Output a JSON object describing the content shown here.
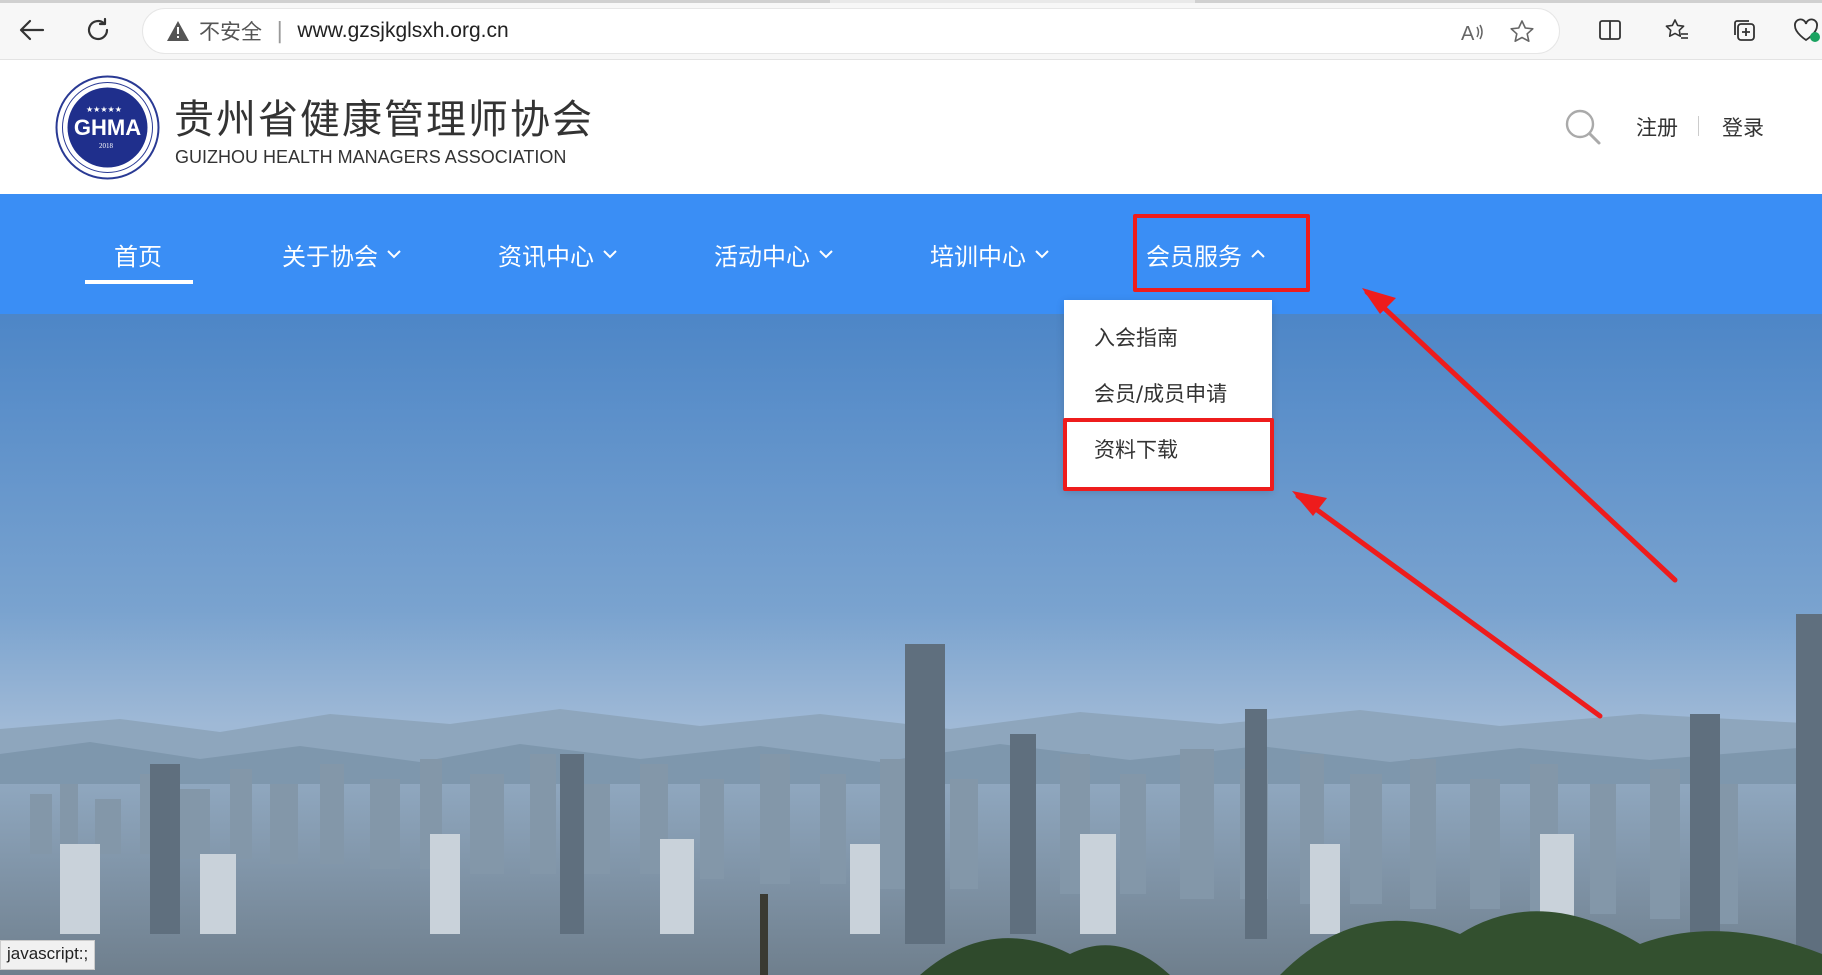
{
  "browser": {
    "insecure_label": "不安全",
    "separator": "|",
    "url": "www.gzsjkglsxh.org.cn",
    "status_bar_text": "javascript:;"
  },
  "site": {
    "title_cn": "贵州省健康管理师协会",
    "title_en": "GUIZHOU HEALTH MANAGERS ASSOCIATION",
    "logo_text": "GHMA",
    "logo_year": "2018",
    "register_label": "注册",
    "login_label": "登录"
  },
  "nav": {
    "items": [
      {
        "label": "首页",
        "active": true,
        "has_dropdown": false
      },
      {
        "label": "关于协会",
        "has_dropdown": true
      },
      {
        "label": "资讯中心",
        "has_dropdown": true
      },
      {
        "label": "活动中心",
        "has_dropdown": true
      },
      {
        "label": "培训中心",
        "has_dropdown": true
      },
      {
        "label": "会员服务",
        "has_dropdown": true,
        "open": true
      }
    ]
  },
  "dropdown": {
    "items": [
      {
        "label": "入会指南"
      },
      {
        "label": "会员/成员申请"
      },
      {
        "label": "资料下载"
      }
    ]
  },
  "colors": {
    "nav_bg": "#3a8ef5",
    "annotation_red": "#ee1c1c",
    "logo_blue": "#1f2f8c"
  }
}
